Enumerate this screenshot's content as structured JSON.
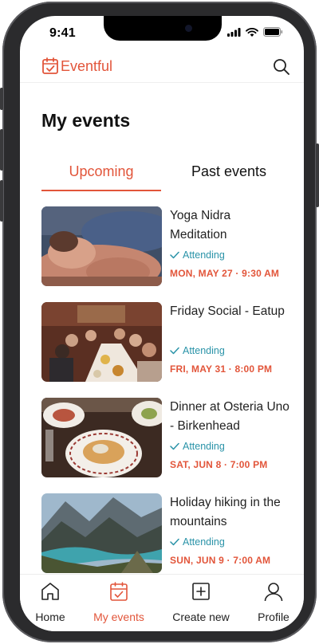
{
  "status_bar": {
    "time": "9:41"
  },
  "app": {
    "brand": "Eventful",
    "accent_color": "#e2553a",
    "status_color": "#2a93a8"
  },
  "page": {
    "title": "My events"
  },
  "tabs": [
    {
      "label": "Upcoming",
      "active": true
    },
    {
      "label": "Past events",
      "active": false
    }
  ],
  "events": [
    {
      "title": "Yoga Nidra Meditation",
      "status": "Attending",
      "date": "MON, MAY 27 · 9:30 AM",
      "image": "yoga-photo"
    },
    {
      "title": "Friday Social - Eatup",
      "status": "Attending",
      "date": "FRI, MAY 31 · 8:00 PM",
      "image": "dinner-group-photo"
    },
    {
      "title": "Dinner at Osteria Uno - Birkenhead",
      "status": "Attending",
      "date": "SAT, JUN 8 · 7:00 PM",
      "image": "food-table-photo"
    },
    {
      "title": "Holiday hiking in the mountains",
      "status": "Attending",
      "date": "SUN, JUN 9 · 7:00 AM",
      "image": "mountain-lake-photo"
    }
  ],
  "bottom_nav": [
    {
      "label": "Home",
      "icon": "home-icon",
      "active": false
    },
    {
      "label": "My events",
      "icon": "calendar-check-icon",
      "active": true
    },
    {
      "label": "Create new",
      "icon": "plus-square-icon",
      "active": false
    },
    {
      "label": "Profile",
      "icon": "user-icon",
      "active": false
    }
  ]
}
